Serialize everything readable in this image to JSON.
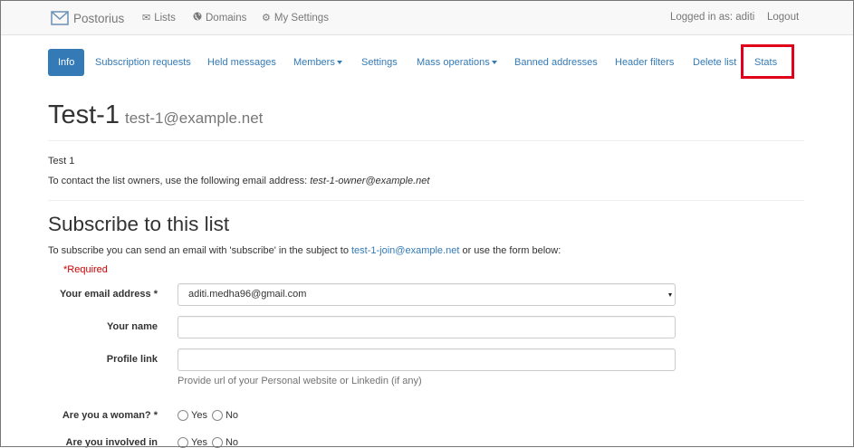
{
  "navbar": {
    "brand": "Postorius",
    "lists": "Lists",
    "domains": "Domains",
    "settings": "My Settings",
    "logged_in": "Logged in as: aditi",
    "logout": "Logout"
  },
  "tabs": [
    {
      "label": "Info",
      "active": true
    },
    {
      "label": "Subscription requests"
    },
    {
      "label": "Held messages"
    },
    {
      "label": "Members"
    },
    {
      "label": "Settings"
    },
    {
      "label": "Mass operations"
    },
    {
      "label": "Banned addresses"
    },
    {
      "label": "Header filters"
    },
    {
      "label": "Delete list"
    },
    {
      "label": "Stats"
    }
  ],
  "header": {
    "title": "Test-1",
    "address": "test-1@example.net"
  },
  "info": {
    "description": "Test 1",
    "contact_prefix": "To contact the list owners, use the following email address:",
    "contact_email": "test-1-owner@example.net"
  },
  "subscribe": {
    "heading": "Subscribe to this list",
    "intro_prefix": "To subscribe you can send an email with 'subscribe' in the subject to",
    "join_email": "test-1-join@example.net",
    "intro_suffix": "or use the form below:",
    "required_note": "*Required",
    "email_label": "Your email address *",
    "email_value": "aditi.medha96@gmail.com",
    "name_label": "Your name",
    "name_value": "",
    "profile_label": "Profile link",
    "profile_value": "",
    "profile_help": "Provide url of your Personal website or Linkedin (if any)",
    "woman_label": "Are you a woman? *",
    "involved_label": "Are you involved in",
    "yes": "Yes",
    "no": "No"
  },
  "colors": {
    "link": "#337ab7",
    "active_tab_bg": "#337ab7",
    "highlight": "#e0001b",
    "required": "#cc0000"
  }
}
